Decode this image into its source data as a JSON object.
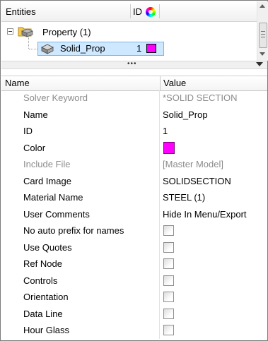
{
  "entities": {
    "title": "Entities",
    "id_header": "ID",
    "property_node": "Property (1)",
    "selected": {
      "name": "Solid_Prop",
      "id": "1",
      "color": "#ff00ff"
    }
  },
  "grip": "•••",
  "table": {
    "name_header": "Name",
    "value_header": "Value",
    "rows": [
      {
        "name": "Solver Keyword",
        "value": "*SOLID SECTION",
        "greyed": true
      },
      {
        "name": "Name",
        "value": "Solid_Prop"
      },
      {
        "name": "ID",
        "value": "1"
      },
      {
        "name": "Color",
        "value_color": "#ff00ff"
      },
      {
        "name": "Include File",
        "value": "[Master Model]",
        "greyed": true
      },
      {
        "name": "Card Image",
        "value": "SOLIDSECTION"
      },
      {
        "name": "Material Name",
        "value": "STEEL (1)"
      },
      {
        "name": "User Comments",
        "value": "Hide In Menu/Export"
      },
      {
        "name": "No auto prefix for names",
        "checked": false
      },
      {
        "name": "Use Quotes",
        "checked": false
      },
      {
        "name": "Ref Node",
        "checked": false
      },
      {
        "name": "Controls",
        "checked": false
      },
      {
        "name": "Orientation",
        "checked": false
      },
      {
        "name": "Data Line",
        "checked": false
      },
      {
        "name": "Hour Glass",
        "checked": false
      }
    ]
  }
}
